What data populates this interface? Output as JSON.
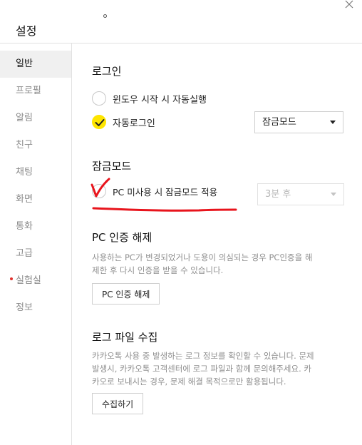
{
  "window": {
    "title": "설정"
  },
  "sidebar": {
    "items": [
      {
        "label": "일반"
      },
      {
        "label": "프로필"
      },
      {
        "label": "알림"
      },
      {
        "label": "친구"
      },
      {
        "label": "채팅"
      },
      {
        "label": "화면"
      },
      {
        "label": "통화"
      },
      {
        "label": "고급"
      },
      {
        "label": "실험실"
      },
      {
        "label": "정보"
      }
    ]
  },
  "login": {
    "title": "로그인",
    "auto_start_label": "윈도우 시작 시 자동실행",
    "auto_login_label": "자동로그인",
    "mode_select_value": "잠금모드"
  },
  "lock_mode": {
    "title": "잠금모드",
    "apply_label": "PC 미사용 시 잠금모드 적용",
    "delay_select_value": "3분 후"
  },
  "pc_auth": {
    "title": "PC 인증 해제",
    "description_line1": "사용하는 PC가 변경되었거나 도용이 의심되는 경우 PC인증을 해",
    "description_line2": "제한 후 다시 인증을 받을 수 있습니다.",
    "button_label": "PC 인증 해제"
  },
  "log_collect": {
    "title": "로그 파일 수집",
    "description_line1": "카카오톡 사용 중 발생하는 로그 정보를 확인할 수 있습니다. 문제",
    "description_line2": "발생시, 카카오톡 고객센터에 로그 파일과 함께 문의해주세요. 카",
    "description_line3": "카오로 보내시는 경우, 문제 해결 목적으로만 활용됩니다.",
    "button_label": "수집하기"
  },
  "colors": {
    "accent_yellow": "#fee500",
    "annotation_red": "#e8141c",
    "lab_dot": "#e0332f"
  },
  "icons": {
    "close": "close-icon",
    "check": "check-icon"
  }
}
